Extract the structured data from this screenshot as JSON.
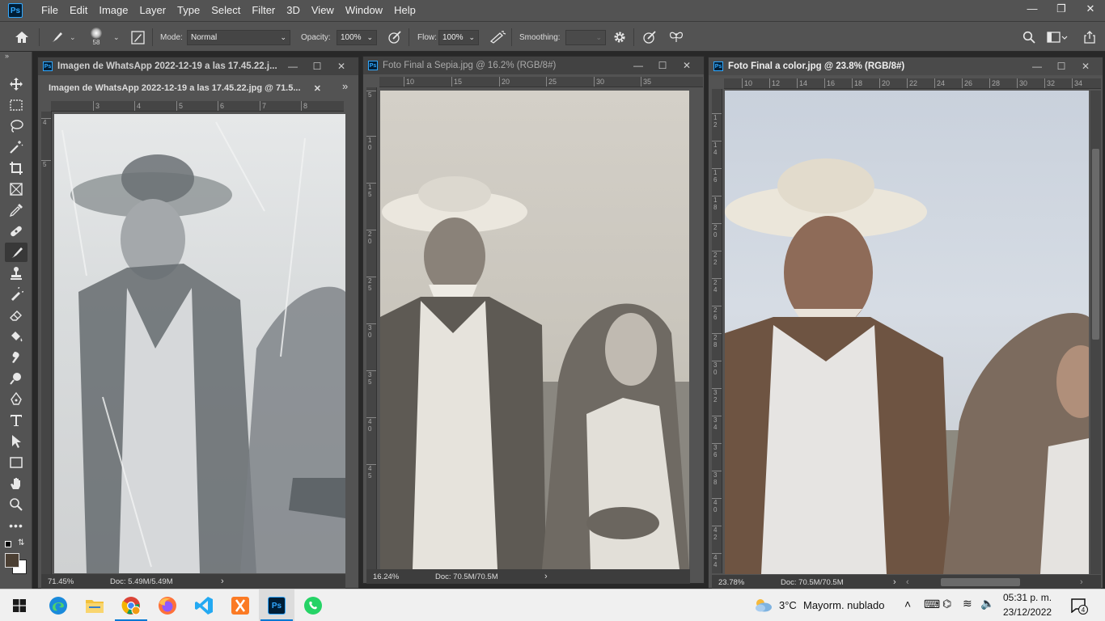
{
  "menubar": {
    "logo": "Ps",
    "items": [
      "File",
      "Edit",
      "Image",
      "Layer",
      "Type",
      "Select",
      "Filter",
      "3D",
      "View",
      "Window",
      "Help"
    ]
  },
  "options": {
    "brush_size": "58",
    "mode_label": "Mode:",
    "mode_value": "Normal",
    "opacity_label": "Opacity:",
    "opacity_value": "100%",
    "flow_label": "Flow:",
    "flow_value": "100%",
    "smoothing_label": "Smoothing:",
    "smoothing_value": ""
  },
  "doc1": {
    "title": "Imagen de WhatsApp 2022-12-19 a las 17.45.22.j...",
    "tab_title": "Imagen de WhatsApp 2022-12-19 a las 17.45.22.jpg @ 71.5...",
    "ruler_h": [
      "3",
      "4",
      "5",
      "6",
      "7",
      "8"
    ],
    "ruler_v": [
      "4",
      "5"
    ],
    "zoom": "71.45%",
    "doc": "Doc: 5.49M/5.49M"
  },
  "doc2": {
    "title": "Foto Final a Sepia.jpg @ 16.2% (RGB/8#)",
    "ruler_h": [
      "10",
      "15",
      "20",
      "25",
      "30",
      "35"
    ],
    "ruler_v": [
      "5",
      "1\n0",
      "1\n5",
      "2\n0",
      "2\n5",
      "3\n0",
      "3\n5",
      "4\n0",
      "4\n5"
    ],
    "zoom": "16.24%",
    "doc": "Doc: 70.5M/70.5M"
  },
  "doc3": {
    "title": "Foto Final a color.jpg @ 23.8% (RGB/8#)",
    "ruler_h": [
      "10",
      "12",
      "14",
      "16",
      "18",
      "20",
      "22",
      "24",
      "26",
      "28",
      "30",
      "32",
      "34"
    ],
    "ruler_v": [
      "1\n2",
      "1\n4",
      "1\n6",
      "1\n8",
      "2\n0",
      "2\n2",
      "2\n4",
      "2\n6",
      "2\n8",
      "3\n0",
      "3\n2",
      "3\n4",
      "3\n6",
      "3\n8",
      "4\n0",
      "4\n2",
      "4\n4"
    ],
    "zoom": "23.78%",
    "doc": "Doc: 70.5M/70.5M"
  },
  "taskbar": {
    "weather_temp": "3°C",
    "weather_desc": "Mayorm. nublado",
    "time": "05:31 p. m.",
    "date": "23/12/2022",
    "notif_count": "4"
  }
}
